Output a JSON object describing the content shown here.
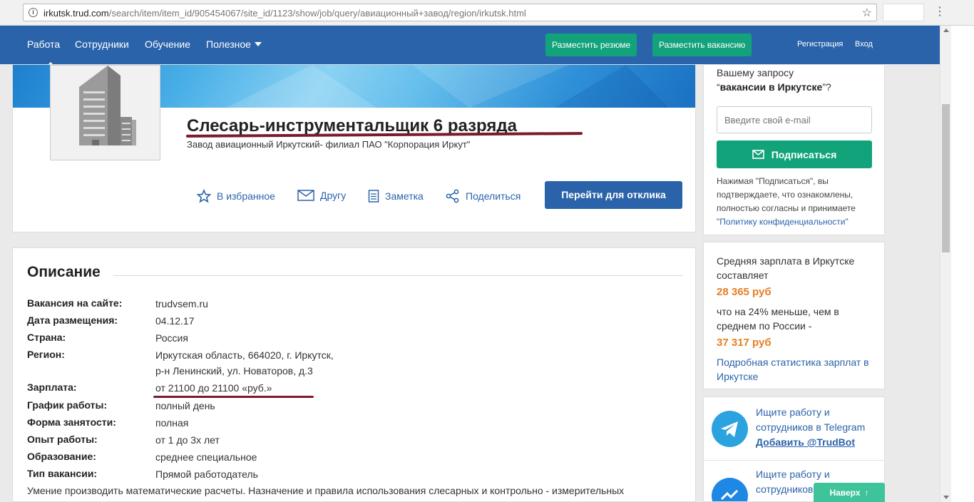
{
  "browser": {
    "url_host": "irkutsk.trud.com",
    "url_path": "/search/item/item_id/905454067/site_id/1123/show/job/query/авиационный+завод/region/irkutsk.html"
  },
  "nav": {
    "items": [
      "Работа",
      "Сотрудники",
      "Обучение",
      "Полезное"
    ],
    "post_resume": "Разместить резюме",
    "post_vacancy": "Разместить вакансию",
    "register": "Регистрация",
    "login": "Вход"
  },
  "job": {
    "title": "Слесарь-инструментальщик 6 разряда",
    "company": "Завод авиационный Иркутский- филиал ПАО \"Корпорация Иркут\"",
    "actions": {
      "favorite": "В избранное",
      "friend": "Другу",
      "note": "Заметка",
      "share": "Поделиться"
    },
    "respond": "Перейти для отклика"
  },
  "description": {
    "heading": "Описание",
    "rows": [
      {
        "k": "Вакансия на сайте:",
        "v": "trudvsem.ru"
      },
      {
        "k": "Дата размещения:",
        "v": "04.12.17"
      },
      {
        "k": "Страна:",
        "v": "Россия"
      },
      {
        "k": "Регион:",
        "v": "Иркутская область, 664020, г. Иркутск,",
        "v2": "р-н Ленинский, ул. Новаторов, д.3"
      },
      {
        "k": "Зарплата:",
        "v": "от 21100 до 21100 «руб.»"
      },
      {
        "k": "График работы:",
        "v": "полный день"
      },
      {
        "k": "Форма занятости:",
        "v": "полная"
      },
      {
        "k": "Опыт работы:",
        "v": "от 1 до 3х лет"
      },
      {
        "k": "Образование:",
        "v": "среднее специальное"
      },
      {
        "k": "Тип вакансии:",
        "v": "Прямой работодатель"
      }
    ],
    "text": "Умение производить математические расчеты. Назначение и правила использования слесарных и контрольно - измерительных"
  },
  "subscribe": {
    "line1": "Вашему запросу",
    "query_open": "“",
    "query": "вакансии в Иркутске",
    "query_close": "”?",
    "email_placeholder": "Введите свой e-mail",
    "button": "Подписаться",
    "note": "Нажимая \"Подписаться\", вы подтверждаете, что ознакомлены, полностью согласны и принимаете",
    "policy": "\"Политику конфиденциальности\""
  },
  "salary": {
    "p1": "Средняя зарплата в Иркутске составляет",
    "local": "28 365 руб",
    "p2": "что на 24% меньше, чем в среднем по России -",
    "national": "37 317 руб",
    "link": "Подробная статистика зарплат в Иркутске"
  },
  "bots": {
    "telegram_text": "Ищите работу и сотрудников в Telegram",
    "telegram_link": "Добавить @TrudBot",
    "messenger_text": "Ищите работу и сотрудников в"
  },
  "to_top": "Наверх",
  "colors": {
    "nav": "#2b63aa",
    "green": "#12a37a",
    "orange": "#e67e22",
    "underline": "#7a1a2a"
  }
}
